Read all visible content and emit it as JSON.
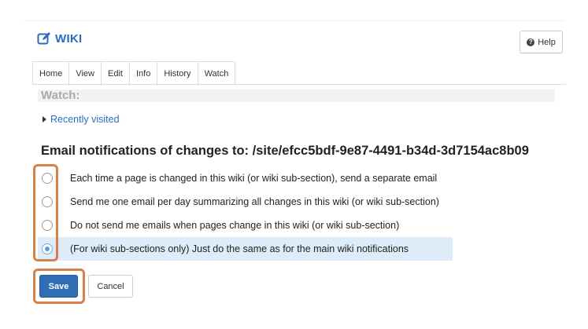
{
  "header": {
    "title": "WIKI",
    "title_icon": "edit-icon",
    "help_label": "Help",
    "help_icon": "question-icon"
  },
  "tabs": [
    {
      "label": "Home"
    },
    {
      "label": "View"
    },
    {
      "label": "Edit"
    },
    {
      "label": "Info"
    },
    {
      "label": "History"
    },
    {
      "label": "Watch"
    }
  ],
  "watch_heading": "Watch:",
  "recently_visited": "Recently visited",
  "email_heading": "Email notifications of changes to: /site/efcc5bdf-9e87-4491-b34d-3d7154ac8b09",
  "options": [
    {
      "label": "Each time a page is changed in this wiki (or wiki sub-section), send a separate email",
      "checked": false
    },
    {
      "label": "Send me one email per day summarizing all changes in this wiki (or wiki sub-section)",
      "checked": false
    },
    {
      "label": "Do not send me emails when pages change in this wiki (or wiki sub-section)",
      "checked": false
    },
    {
      "label": "(For wiki sub-sections only) Just do the same as for the main wiki notifications",
      "checked": true
    }
  ],
  "buttons": {
    "save": "Save",
    "cancel": "Cancel"
  },
  "colors": {
    "accent": "#2a6ebb",
    "save_button": "#2f6db5",
    "highlight_outline": "#d9804a",
    "selected_row": "#ddecf8"
  }
}
